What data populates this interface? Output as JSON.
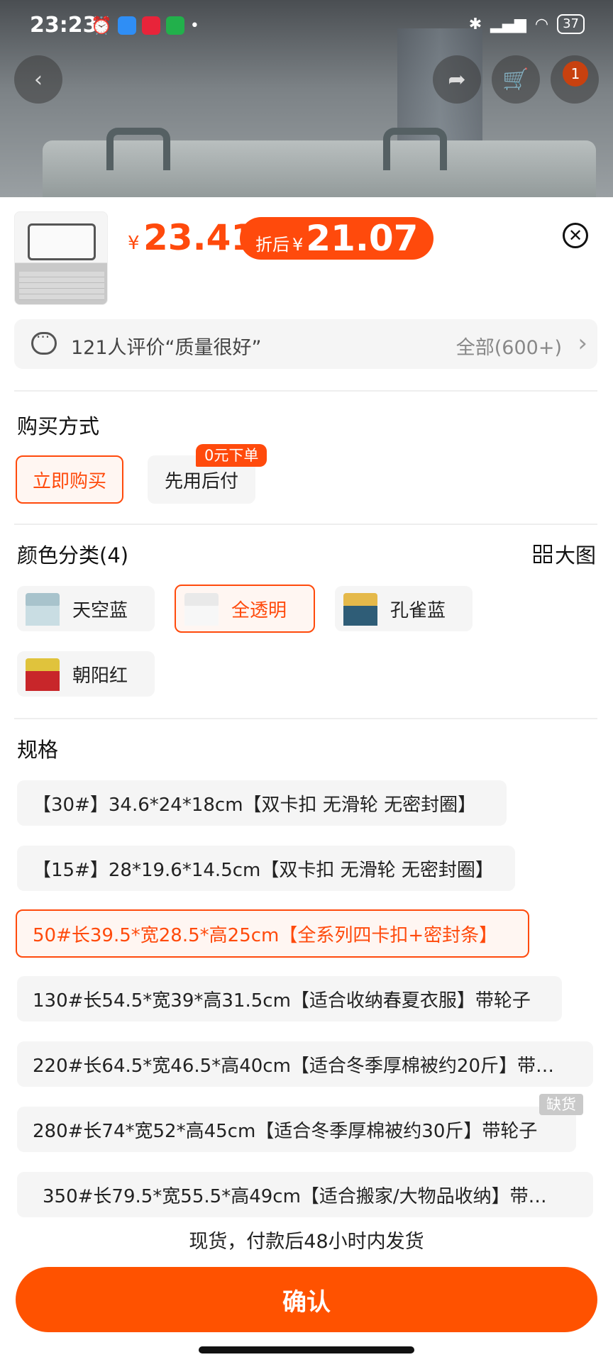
{
  "status_bar": {
    "time": "23:23",
    "battery": "37"
  },
  "header": {
    "cart_badge": "1"
  },
  "product": {
    "price_symbol": "¥",
    "price": "23.41",
    "discount_label": "折后",
    "discount_symbol": "¥",
    "discount_price": "21.07"
  },
  "review": {
    "summary": "121人评价“质量很好”",
    "all_label": "全部(600+)"
  },
  "purchase": {
    "title": "购买方式",
    "options": [
      {
        "label": "立即购买",
        "selected": true
      },
      {
        "label": "先用后付",
        "badge": "0元下单",
        "selected": false
      }
    ]
  },
  "color": {
    "title": "颜色分类(4)",
    "big_image_label": "大图",
    "options": [
      {
        "label": "天空蓝",
        "selected": false,
        "lid": "#a8c3cc",
        "body": "#c9dde3"
      },
      {
        "label": "全透明",
        "selected": true,
        "lid": "#e9e9e9",
        "body": "#f7f7f7"
      },
      {
        "label": "孔雀蓝",
        "selected": false,
        "lid": "#e5b94a",
        "body": "#2f5d77"
      },
      {
        "label": "朝阳红",
        "selected": false,
        "lid": "#e0c33c",
        "body": "#c8262a"
      }
    ]
  },
  "spec": {
    "title": "规格",
    "options": [
      {
        "label": "【30#】34.6*24*18cm【双卡扣 无滑轮 无密封圈】",
        "selected": false
      },
      {
        "label": "【15#】28*19.6*14.5cm【双卡扣 无滑轮 无密封圈】",
        "selected": false
      },
      {
        "label": "50#长39.5*宽28.5*高25cm【全系列四卡扣+密封条】",
        "selected": true
      },
      {
        "label": "130#长54.5*宽39*高31.5cm【适合收纳春夏衣服】带轮子",
        "selected": false
      },
      {
        "label": "220#长64.5*宽46.5*高40cm【适合冬季厚棉被约20斤】带…",
        "selected": false
      },
      {
        "label": "280#长74*宽52*高45cm【适合冬季厚棉被约30斤】带轮子",
        "selected": false,
        "badge": "缺货"
      },
      {
        "label": "350#长79.5*宽55.5*高49cm【适合搬家/大物品收纳】带…",
        "selected": false
      }
    ]
  },
  "shipping_note": "现货，付款后48小时内发货",
  "confirm_label": "确认",
  "colors": {
    "accent": "#ff4a0c",
    "confirm": "#ff5200"
  }
}
